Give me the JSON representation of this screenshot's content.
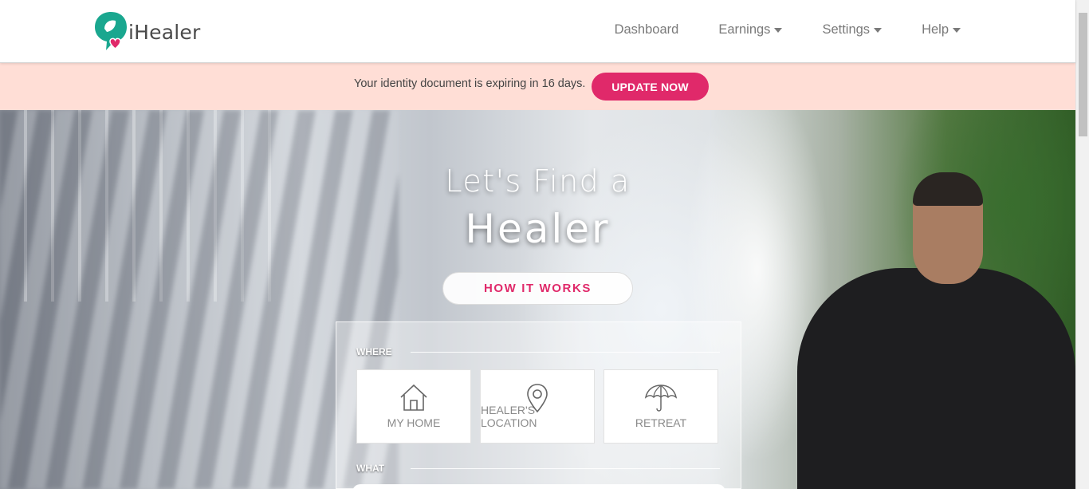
{
  "brand": {
    "name": "iHealer"
  },
  "nav": {
    "items": [
      {
        "label": "Dashboard",
        "dropdown": false
      },
      {
        "label": "Earnings",
        "dropdown": true
      },
      {
        "label": "Settings",
        "dropdown": true
      },
      {
        "label": "Help",
        "dropdown": true
      }
    ]
  },
  "alert": {
    "message": "Your identity document is expiring in 16 days.",
    "button_label": "UPDATE NOW",
    "background_color": "#ffded6",
    "accent_color": "#e0296a"
  },
  "hero": {
    "headline_line1": "Let's Find a",
    "headline_line2": "Healer",
    "how_it_works_label": "HOW IT WORKS"
  },
  "search": {
    "where_label": "WHERE",
    "what_label": "WHAT",
    "where_options": [
      {
        "label": "MY HOME",
        "icon": "house-icon"
      },
      {
        "label": "HEALER'S LOCATION",
        "icon": "map-pin-icon"
      },
      {
        "label": "RETREAT",
        "icon": "umbrella-icon"
      }
    ]
  },
  "colors": {
    "brand_teal": "#1aa78f",
    "brand_pink": "#e0296a"
  }
}
